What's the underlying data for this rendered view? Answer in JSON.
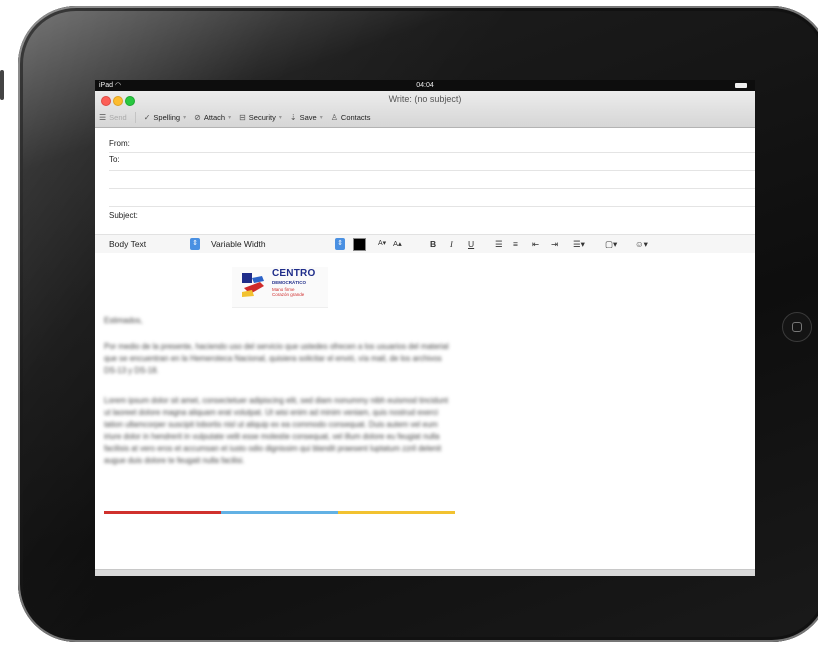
{
  "status_bar": {
    "device": "iPad",
    "time": "04:04"
  },
  "window": {
    "title": "Write: (no subject)"
  },
  "toolbar": {
    "send": "Send",
    "spelling": "Spelling",
    "attach": "Attach",
    "security": "Security",
    "save": "Save",
    "contacts": "Contacts"
  },
  "headers": {
    "from": "From:",
    "to": "To:",
    "subject": "Subject:"
  },
  "format_bar": {
    "paragraph_style": "Body Text",
    "font": "Variable Width",
    "bold": "B",
    "italic": "I",
    "underline": "U",
    "text_color": "#000000"
  },
  "logo": {
    "name": "CENTRO",
    "subtitle": "DEMOCRÁTICO",
    "slogan_1": "Mano firme",
    "slogan_2": "Corazón grande"
  },
  "message": {
    "greeting": "Estimados,",
    "paragraph_1": "Por medio de la presente, haciendo uso del servicio que ustedes ofrecen a los usuarios del material que se encuentran en la Hemeroteca Nacional, quisiera solicitar el envió, vía mail, de los archivos DS-13 y DS-18.",
    "paragraph_2": "Lorem ipsum dolor sit amet, consectetuer adipiscing elit, sed diam nonummy nibh euismod tincidunt ut laoreet dolore magna aliquam erat volutpat. Ut wisi enim ad minim veniam, quis nostrud exerci tation ullamcorper suscipit lobortis nisl ut aliquip ex ea commodo consequat. Duis autem vel eum iriure dolor in hendrerit in vulputate velit esse molestie consequat, vel illum dolore eu feugiat nulla facilisis at vero eros et accumsan et iusto odio dignissim qui blandit praesent luptatum zzril delenit augue duis dolore te feugait nulla facilisi."
  },
  "colors": {
    "flag_red": "#d0312d",
    "flag_blue": "#62b1e4",
    "flag_yellow": "#f2c230",
    "logo_blue": "#1f2d8a",
    "logo_red": "#cf2b2b"
  }
}
